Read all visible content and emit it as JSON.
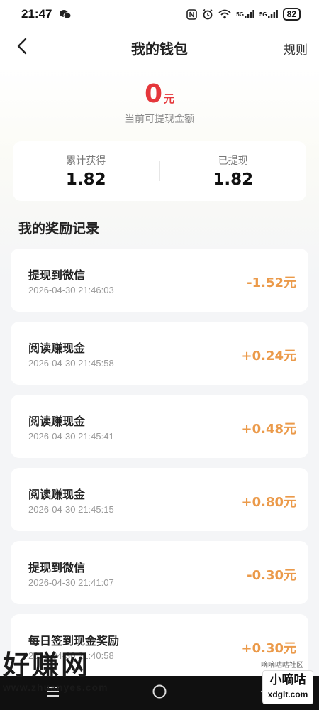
{
  "status_bar": {
    "time": "21:47",
    "battery": "82",
    "icons": [
      "wechat-icon",
      "nfc-icon",
      "alarm-icon",
      "wifi-icon",
      "signal-5g-icon",
      "signal-5g-icon"
    ],
    "network_labels": [
      "5G",
      "5G"
    ]
  },
  "header": {
    "title": "我的钱包",
    "rules_label": "规则",
    "back_icon": "chevron-left-icon"
  },
  "balance": {
    "amount": "0",
    "unit": "元",
    "caption": "当前可提现金额",
    "color": "#e5373b"
  },
  "stats": {
    "earned_label": "累计获得",
    "earned_value": "1.82",
    "withdrawn_label": "已提现",
    "withdrawn_value": "1.82"
  },
  "records_title": "我的奖励记录",
  "records": [
    {
      "title": "提现到微信",
      "time": "2026-04-30 21:46:03",
      "amount": "-1.52元"
    },
    {
      "title": "阅读赚现金",
      "time": "2026-04-30 21:45:58",
      "amount": "+0.24元"
    },
    {
      "title": "阅读赚现金",
      "time": "2026-04-30 21:45:41",
      "amount": "+0.48元"
    },
    {
      "title": "阅读赚现金",
      "time": "2026-04-30 21:45:15",
      "amount": "+0.80元"
    },
    {
      "title": "提现到微信",
      "time": "2026-04-30 21:41:07",
      "amount": "-0.30元"
    },
    {
      "title": "每日签到现金奖励",
      "time": "2026-04-30 21:40:58",
      "amount": "+0.30元"
    }
  ],
  "amount_color": "#eb9a4a",
  "nav_bar": {
    "icons": [
      "menu-icon",
      "home-icon",
      "back-triangle-icon"
    ]
  },
  "watermarks": {
    "left_big": "好赚网",
    "left_small": "www.zhuanyes.com",
    "right_big": "小嘀咕",
    "right_small": "xdglt.com",
    "mid_small": "嘀嘀咕咕社区"
  }
}
